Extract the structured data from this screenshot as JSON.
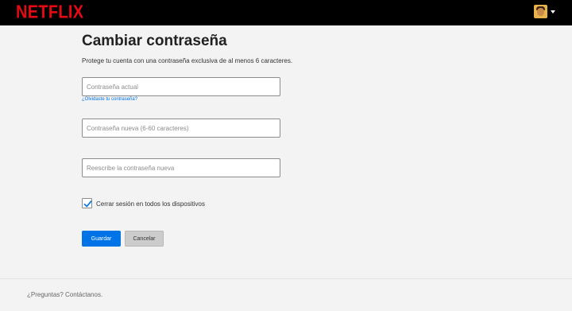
{
  "header": {
    "logo": "NETFLIX",
    "avatar_icon": "user-avatar",
    "menu_icon": "caret-down-icon"
  },
  "page": {
    "title": "Cambiar contraseña",
    "description": "Protege tu cuenta con una contraseña exclusiva de al menos 6 caracteres."
  },
  "form": {
    "current_password": {
      "placeholder": "Contraseña actual",
      "value": ""
    },
    "forgot_link": "¿Olvidaste tu contraseña?",
    "new_password": {
      "placeholder": "Contraseña nueva (6-60 caracteres)",
      "value": ""
    },
    "confirm_password": {
      "placeholder": "Reescribe la contraseña nueva",
      "value": ""
    },
    "signout_checkbox": {
      "label": "Cerrar sesión en todos los dispositivos",
      "checked": true
    },
    "save_label": "Guardar",
    "cancel_label": "Cancelar"
  },
  "footer": {
    "question": "¿Preguntas?",
    "contact_link": "Contáctanos."
  },
  "colors": {
    "brand_red": "#e50914",
    "primary_blue": "#0073e6",
    "background": "#f3f3f3"
  }
}
